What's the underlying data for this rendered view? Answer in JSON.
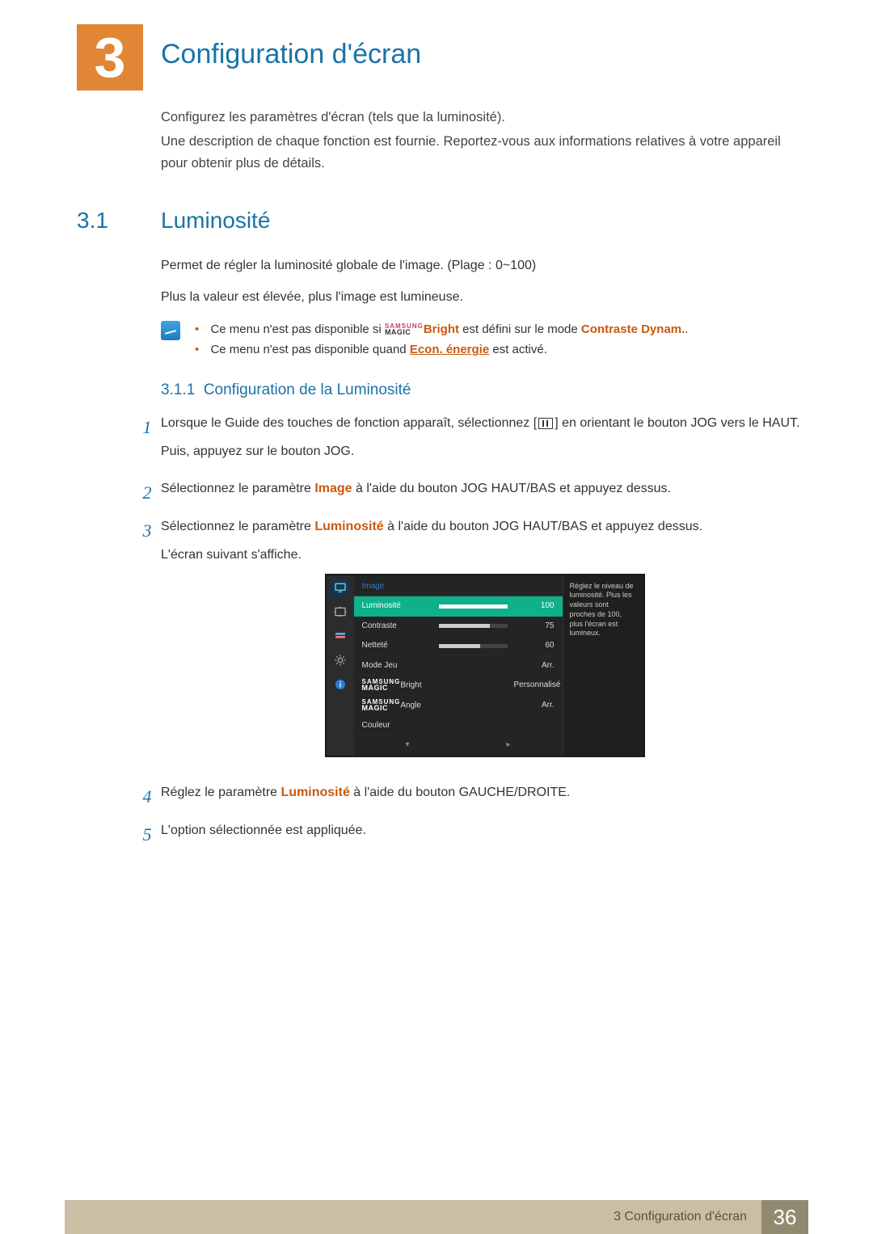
{
  "chapter": {
    "number": "3",
    "title": "Configuration d'écran"
  },
  "intro": {
    "p1": "Configurez les paramètres d'écran (tels que la luminosité).",
    "p2": "Une description de chaque fonction est fournie. Reportez-vous aux informations relatives à votre appareil pour obtenir plus de détails."
  },
  "section": {
    "number": "3.1",
    "title": "Luminosité"
  },
  "body": {
    "p1": "Permet de régler la luminosité globale de l'image. (Plage : 0~100)",
    "p2": "Plus la valeur est élevée, plus l'image est lumineuse."
  },
  "notes": {
    "item1_pre": "Ce menu n'est pas disponible si ",
    "item1_bright": "Bright",
    "item1_mid": " est défini sur le mode ",
    "item1_mode": "Contraste Dynam.",
    "item1_post": ".",
    "item2_pre": "Ce menu n'est pas disponible quand ",
    "item2_link": "Econ. énergie",
    "item2_post": " est activé."
  },
  "magic": {
    "top": "SAMSUNG",
    "bot": "MAGIC"
  },
  "subsection": {
    "number": "3.1.1",
    "title": "Configuration de la Luminosité"
  },
  "steps": {
    "s1_a": "Lorsque le Guide des touches de fonction apparaît, sélectionnez [",
    "s1_b": "] en orientant le bouton JOG vers le HAUT.",
    "s1_c": "Puis, appuyez sur le bouton JOG.",
    "s2_a": "Sélectionnez le paramètre ",
    "s2_b": "Image",
    "s2_c": " à l'aide du bouton JOG HAUT/BAS et appuyez dessus.",
    "s3_a": "Sélectionnez le paramètre ",
    "s3_b": "Luminosité",
    "s3_c": " à l'aide du bouton JOG HAUT/BAS et appuyez dessus.",
    "s3_d": "L'écran suivant s'affiche.",
    "s4_a": "Réglez le paramètre ",
    "s4_b": "Luminosité",
    "s4_c": " à l'aide du bouton GAUCHE/DROITE.",
    "s5": "L'option sélectionnée est appliquée."
  },
  "osd": {
    "title": "Image",
    "rows": [
      {
        "label": "Luminosité",
        "val": "100",
        "fill": 100,
        "selected": true
      },
      {
        "label": "Contraste",
        "val": "75",
        "fill": 75
      },
      {
        "label": "Netteté",
        "val": "60",
        "fill": 60
      },
      {
        "label": "Mode Jeu",
        "val": "Arr."
      },
      {
        "label": "Bright",
        "val": "Personnalisé",
        "magic": true
      },
      {
        "label": "Angle",
        "val": "Arr.",
        "magic": true
      },
      {
        "label": "Couleur",
        "val": ""
      }
    ],
    "help": "Réglez le niveau de luminosité. Plus les valeurs sont proches de 100, plus l'écran est lumineux.",
    "nav_down": "▾",
    "nav_right": "▸"
  },
  "footer": {
    "chapter": "3 Configuration d'écran",
    "page": "36"
  }
}
